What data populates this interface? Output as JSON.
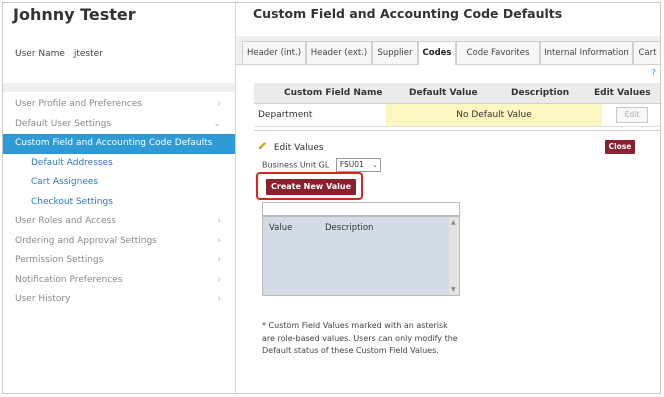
{
  "sidebar": {
    "user_display_name": "Johnny Tester",
    "username_label": "User Name",
    "username_value": "jtester",
    "items": [
      {
        "label": "User Profile and Preferences",
        "chevron": "›"
      },
      {
        "label": "Default User Settings",
        "chevron": "⌄"
      },
      {
        "label": "Custom Field and Accounting Code Defaults",
        "chevron": ""
      },
      {
        "label": "Default Addresses",
        "chevron": ""
      },
      {
        "label": "Cart Assignees",
        "chevron": ""
      },
      {
        "label": "Checkout Settings",
        "chevron": ""
      },
      {
        "label": "User Roles and Access",
        "chevron": "›"
      },
      {
        "label": "Ordering and Approval Settings",
        "chevron": "›"
      },
      {
        "label": "Permission Settings",
        "chevron": "›"
      },
      {
        "label": "Notification Preferences",
        "chevron": "›"
      },
      {
        "label": "User History",
        "chevron": "›"
      }
    ]
  },
  "main": {
    "title": "Custom Field and Accounting Code Defaults",
    "tabs": [
      {
        "label": "Header (int.)"
      },
      {
        "label": "Header (ext.)"
      },
      {
        "label": "Supplier"
      },
      {
        "label": "Codes"
      },
      {
        "label": "Code Favorites"
      },
      {
        "label": "Internal Information"
      },
      {
        "label": "Cart"
      }
    ],
    "help": "?",
    "table": {
      "headers": [
        "Custom Field Name",
        "Default Value",
        "Description",
        "Edit Values"
      ],
      "rows": [
        {
          "name": "Department",
          "default_value": "No Default Value",
          "edit_label": "Edit"
        }
      ]
    },
    "edit_panel": {
      "title": "Edit Values",
      "close_label": "Close",
      "business_unit_label": "Business Unit GL",
      "business_unit_value": "FSU01",
      "create_button": "Create New Value",
      "list_headers": [
        "Value",
        "Description"
      ],
      "note": "* Custom Field Values marked with an asterisk are role-based values. Users can only modify the Default status of these Custom Field Values."
    }
  },
  "colors": {
    "accent": "#2e9bd6",
    "button": "#8b2130",
    "highlight": "#e8201c",
    "default_value_bg": "#fcf6c1"
  }
}
